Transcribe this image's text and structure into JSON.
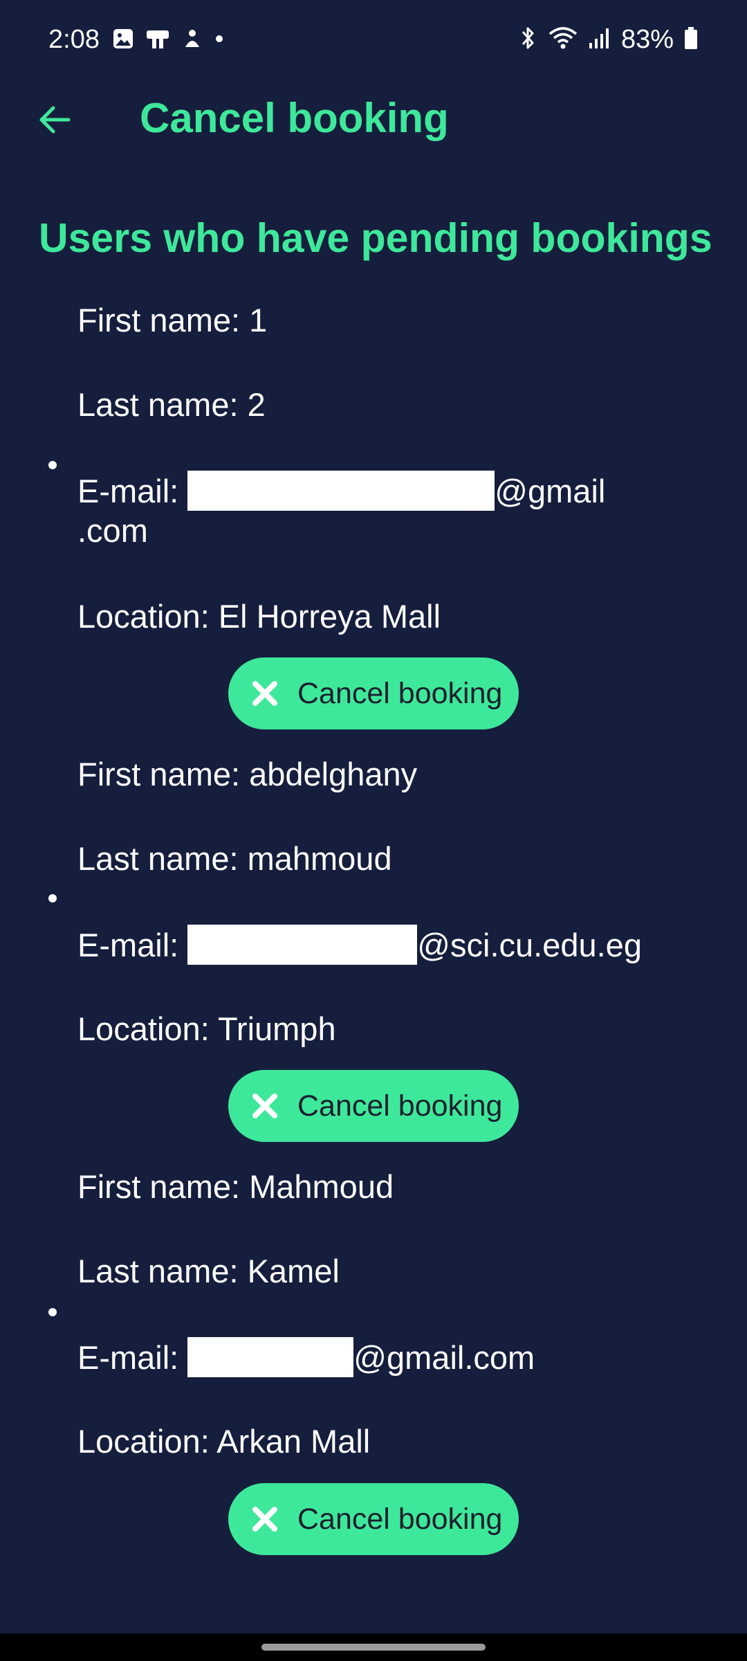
{
  "status_bar": {
    "time": "2:08",
    "battery": "83%",
    "left_icons": [
      "gallery-icon",
      "remote-icon",
      "app-icon",
      "dot-icon"
    ],
    "right_icons": [
      "bluetooth-icon",
      "wifi-icon",
      "signal-icon",
      "battery-icon"
    ]
  },
  "app_bar": {
    "title": "Cancel booking",
    "back_icon": "arrow-back-icon"
  },
  "section": {
    "title": "Users who have pending bookings"
  },
  "bookings": [
    {
      "first_name": "First name: 1",
      "last_name": "Last name: 2",
      "email_label": "E-mail: ",
      "email_domain": "@gmail",
      "email_domain_wrap": ".com",
      "location": "Location: El Horreya Mall",
      "button_label": "Cancel booking"
    },
    {
      "first_name": "First name: abdelghany",
      "last_name": "Last name: mahmoud",
      "email_label": "E-mail: ",
      "email_domain": "@sci.cu.edu.eg",
      "location": "Location: Triumph",
      "button_label": "Cancel booking"
    },
    {
      "first_name": "First name: Mahmoud",
      "last_name": "Last name: Kamel",
      "email_label": "E-mail: ",
      "email_domain": "@gmail.com",
      "location": "Location: Arkan Mall",
      "button_label": "Cancel booking"
    }
  ],
  "colors": {
    "background": "#161e3d",
    "accent": "#3ee89a",
    "text": "#ffffff"
  }
}
